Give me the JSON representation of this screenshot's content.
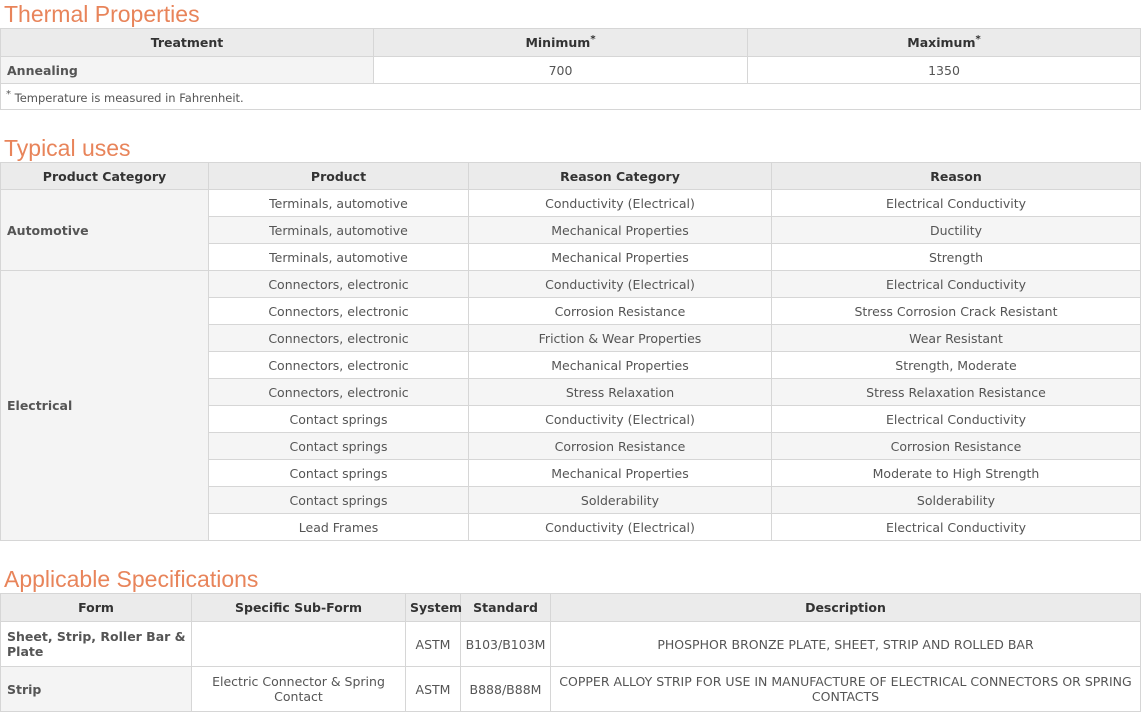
{
  "thermal": {
    "title": "Thermal Properties",
    "headers": {
      "treatment": "Treatment",
      "minimum": "Minimum",
      "maximum": "Maximum",
      "mark": "*"
    },
    "rows": [
      {
        "treatment": "Annealing",
        "minimum": "700",
        "maximum": "1350"
      }
    ],
    "footnote_mark": "*",
    "footnote": "Temperature is measured in Fahrenheit."
  },
  "uses": {
    "title": "Typical uses",
    "headers": {
      "product_category": "Product Category",
      "product": "Product",
      "reason_category": "Reason Category",
      "reason": "Reason"
    },
    "groups": [
      {
        "category": "Automotive",
        "rows": [
          {
            "product": "Terminals, automotive",
            "reason_category": "Conductivity (Electrical)",
            "reason": "Electrical Conductivity"
          },
          {
            "product": "Terminals, automotive",
            "reason_category": "Mechanical Properties",
            "reason": "Ductility"
          },
          {
            "product": "Terminals, automotive",
            "reason_category": "Mechanical Properties",
            "reason": "Strength"
          }
        ]
      },
      {
        "category": "Electrical",
        "rows": [
          {
            "product": "Connectors, electronic",
            "reason_category": "Conductivity (Electrical)",
            "reason": "Electrical Conductivity"
          },
          {
            "product": "Connectors, electronic",
            "reason_category": "Corrosion Resistance",
            "reason": "Stress Corrosion Crack Resistant"
          },
          {
            "product": "Connectors, electronic",
            "reason_category": "Friction & Wear Properties",
            "reason": "Wear Resistant"
          },
          {
            "product": "Connectors, electronic",
            "reason_category": "Mechanical Properties",
            "reason": "Strength, Moderate"
          },
          {
            "product": "Connectors, electronic",
            "reason_category": "Stress Relaxation",
            "reason": "Stress Relaxation Resistance"
          },
          {
            "product": "Contact springs",
            "reason_category": "Conductivity (Electrical)",
            "reason": "Electrical Conductivity"
          },
          {
            "product": "Contact springs",
            "reason_category": "Corrosion Resistance",
            "reason": "Corrosion Resistance"
          },
          {
            "product": "Contact springs",
            "reason_category": "Mechanical Properties",
            "reason": "Moderate to High Strength"
          },
          {
            "product": "Contact springs",
            "reason_category": "Solderability",
            "reason": "Solderability"
          },
          {
            "product": "Lead Frames",
            "reason_category": "Conductivity (Electrical)",
            "reason": "Electrical Conductivity"
          }
        ]
      }
    ]
  },
  "specs": {
    "title": "Applicable Specifications",
    "headers": {
      "form": "Form",
      "sub_form": "Specific Sub-Form",
      "system": "System",
      "standard": "Standard",
      "description": "Description"
    },
    "rows": [
      {
        "form": "Sheet, Strip, Roller Bar & Plate",
        "sub_form": "",
        "system": "ASTM",
        "standard": "B103/B103M",
        "description": "PHOSPHOR BRONZE PLATE, SHEET, STRIP AND ROLLED BAR"
      },
      {
        "form": "Strip",
        "sub_form": "Electric Connector & Spring Contact",
        "system": "ASTM",
        "standard": "B888/B88M",
        "description": "COPPER ALLOY STRIP FOR USE IN MANUFACTURE OF ELECTRICAL CONNECTORS OR SPRING CONTACTS"
      }
    ]
  }
}
